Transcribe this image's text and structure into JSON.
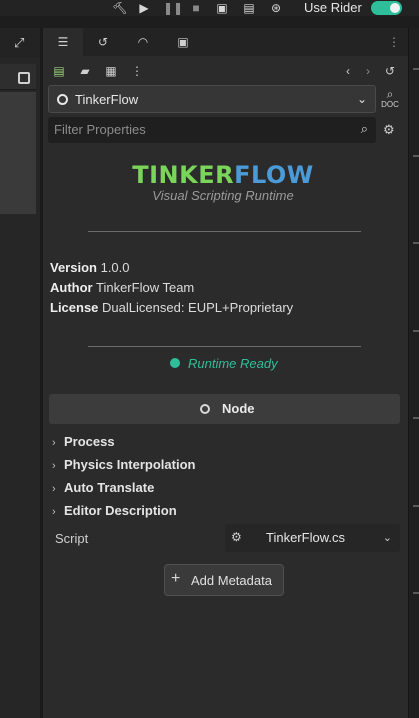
{
  "toolbar": {
    "use_rider_label": "Use Rider",
    "use_rider_enabled": true
  },
  "inspector": {
    "node_name": "TinkerFlow",
    "filter_placeholder": "Filter Properties",
    "doc_label": "DOC"
  },
  "about": {
    "logo_part1": "TINKER",
    "logo_part2": "FLOW",
    "tagline": "Visual Scripting Runtime",
    "fields": [
      {
        "label": "Version",
        "value": "1.0.0"
      },
      {
        "label": "Author",
        "value": "TinkerFlow Team"
      },
      {
        "label": "License",
        "value": "DualLicensed: EUPL+Proprietary"
      }
    ],
    "status": "Runtime Ready",
    "status_color": "#2ebf9a",
    "logo_colors": {
      "part1": "#7ad55a",
      "part2": "#4b9bd8"
    }
  },
  "node_section": {
    "header": "Node",
    "groups": [
      "Process",
      "Physics Interpolation",
      "Auto Translate",
      "Editor Description"
    ],
    "script_label": "Script",
    "script_value": "TinkerFlow.cs",
    "add_metadata": "Add Metadata"
  },
  "icons": {
    "hammer": "hammer-icon",
    "play": "play-icon",
    "pause": "pause-icon",
    "stop": "stop-icon",
    "play_scene": "movie-clapper-icon",
    "play_custom": "movie-clapper-edit-icon",
    "movie_maker": "film-reel-icon"
  }
}
